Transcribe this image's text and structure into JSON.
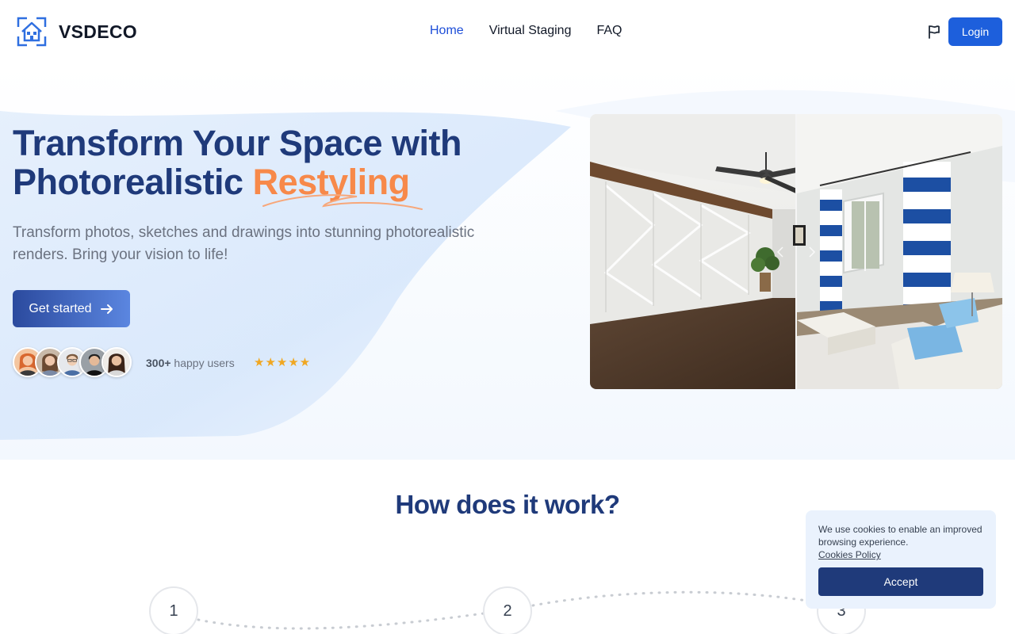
{
  "brand": {
    "name": "VSDECO",
    "icon": "house-logo-icon"
  },
  "nav": {
    "items": [
      {
        "label": "Home",
        "active": true
      },
      {
        "label": "Virtual Staging",
        "active": false
      },
      {
        "label": "FAQ",
        "active": false
      }
    ]
  },
  "header": {
    "flag_icon": "flag-icon",
    "login_label": "Login"
  },
  "hero": {
    "title_line1": "Transform Your Space with",
    "title_line2_prefix": "Photorealistic ",
    "title_accent": "Restyling",
    "subtitle": "Transform photos, sketches and drawings into stunning photorealistic renders. Bring your vision to life!",
    "cta_label": "Get started",
    "users_count": "300+",
    "users_label": " happy users",
    "stars": "★★★★★",
    "rating": 5
  },
  "how": {
    "title": "How does it work?",
    "steps": [
      "1",
      "2",
      "3"
    ]
  },
  "cookie": {
    "text": "We use cookies to enable an improved browsing experience.",
    "link": "Cookies Policy",
    "accept_label": "Accept"
  },
  "colors": {
    "primary": "#1d5fdc",
    "navy": "#1f3a7a",
    "accent": "#f7894a",
    "star": "#f0a722"
  }
}
